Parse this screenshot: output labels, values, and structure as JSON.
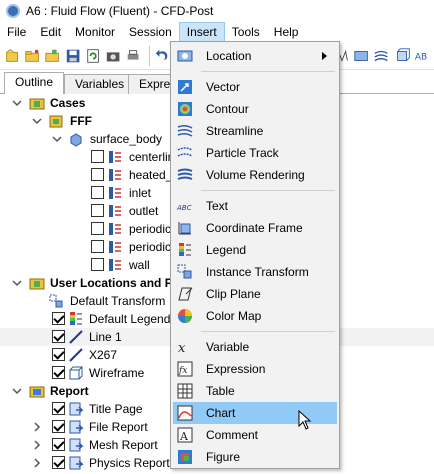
{
  "window": {
    "title": "A6 : Fluid Flow (Fluent) - CFD-Post"
  },
  "menubar": {
    "items": [
      "File",
      "Edit",
      "Monitor",
      "Session",
      "Insert",
      "Tools",
      "Help"
    ],
    "active": "Insert"
  },
  "tabs": {
    "items": [
      "Outline",
      "Variables",
      "Expres"
    ],
    "selected": "Outline"
  },
  "tree": {
    "cases_label": "Cases",
    "case_name": "FFF",
    "surface_body": "surface_body",
    "surfaces": [
      "centerlin",
      "heated_",
      "inlet",
      "outlet",
      "periodic",
      "periodic",
      "wall"
    ],
    "user_locations_label": "User Locations and Pl",
    "default_transform": "Default Transform",
    "default_legend": "Default Legend V",
    "line1": "Line 1",
    "x267": "X267",
    "wireframe": "Wireframe",
    "report_label": "Report",
    "report_items": [
      "Title Page",
      "File Report",
      "Mesh Report",
      "Physics Report"
    ]
  },
  "insert_menu": {
    "items": [
      {
        "label": "Location",
        "icon": "location-icon",
        "submenu": true
      },
      {
        "label": "Vector",
        "icon": "vector-icon"
      },
      {
        "label": "Contour",
        "icon": "contour-icon"
      },
      {
        "label": "Streamline",
        "icon": "streamline-icon"
      },
      {
        "label": "Particle Track",
        "icon": "particle-track-icon"
      },
      {
        "label": "Volume Rendering",
        "icon": "volume-rendering-icon"
      },
      {
        "label": "Text",
        "icon": "text-icon"
      },
      {
        "label": "Coordinate Frame",
        "icon": "coordinate-frame-icon"
      },
      {
        "label": "Legend",
        "icon": "legend-icon"
      },
      {
        "label": "Instance Transform",
        "icon": "instance-transform-icon"
      },
      {
        "label": "Clip Plane",
        "icon": "clip-plane-icon"
      },
      {
        "label": "Color Map",
        "icon": "color-map-icon"
      },
      {
        "label": "Variable",
        "icon": "variable-icon"
      },
      {
        "label": "Expression",
        "icon": "expression-icon"
      },
      {
        "label": "Table",
        "icon": "table-icon"
      },
      {
        "label": "Chart",
        "icon": "chart-icon",
        "hover": true
      },
      {
        "label": "Comment",
        "icon": "comment-icon"
      },
      {
        "label": "Figure",
        "icon": "figure-icon"
      }
    ]
  },
  "colors": {
    "menu_hover": "#91c9f7",
    "active_menu": "#cce4f7",
    "menu_bg": "#f2f2f2"
  }
}
